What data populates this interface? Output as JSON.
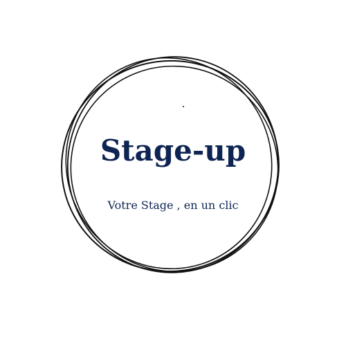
{
  "logo": {
    "brand_name": "Stage-up",
    "tagline": "Votre Stage , en un clic",
    "icon": "hand-drawn-circle-icon"
  },
  "colors": {
    "background": "#ffffff",
    "text": "#0e2452",
    "stroke": "#111111"
  }
}
